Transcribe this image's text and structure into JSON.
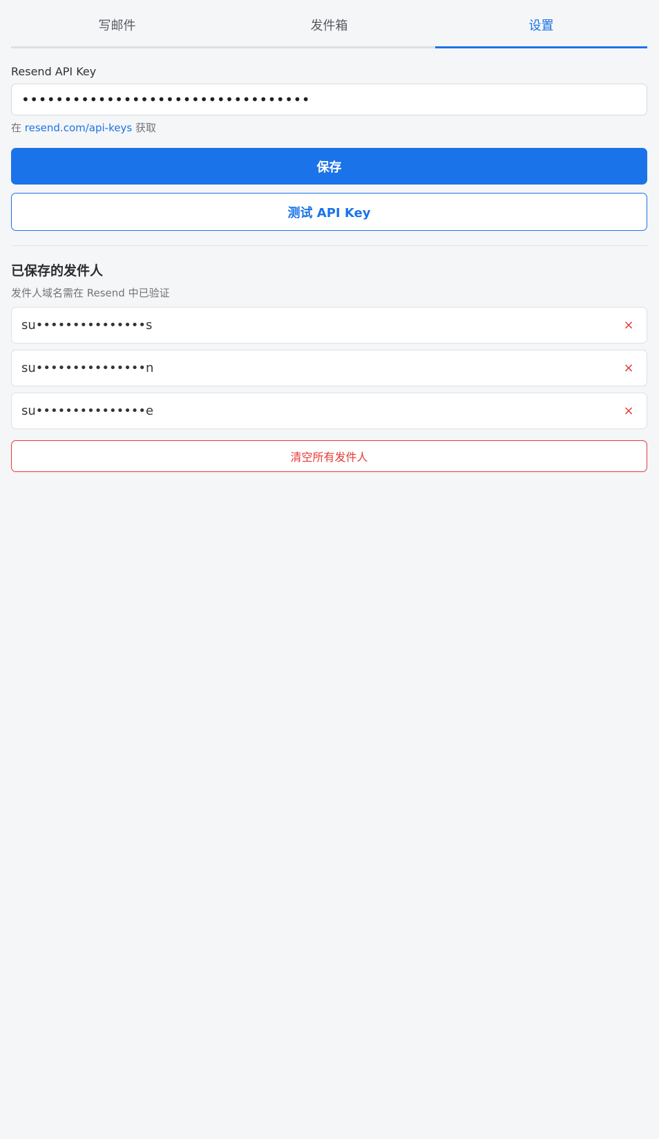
{
  "tabs": [
    {
      "label": "写邮件"
    },
    {
      "label": "发件箱"
    },
    {
      "label": "设置"
    }
  ],
  "api_key": {
    "label": "Resend API Key",
    "value": "••••••••••••••••••••••••••••••••••",
    "hint_prefix": "在",
    "hint_link": "resend.com/api-keys",
    "hint_suffix": "获取"
  },
  "buttons": {
    "save": "保存",
    "test": "测试 API Key",
    "clear_all": "清空所有发件人"
  },
  "senders": {
    "title": "已保存的发件人",
    "subtitle": "发件人域名需在 Resend 中已验证",
    "items": [
      {
        "address": "su•••••••••••••••s",
        "remove": "×"
      },
      {
        "address": "su•••••••••••••••n",
        "remove": "×"
      },
      {
        "address": "su•••••••••••••••e",
        "remove": "×"
      }
    ]
  },
  "colors": {
    "accent": "#1a73e8",
    "danger": "#e53935",
    "background": "#f5f6f8"
  }
}
